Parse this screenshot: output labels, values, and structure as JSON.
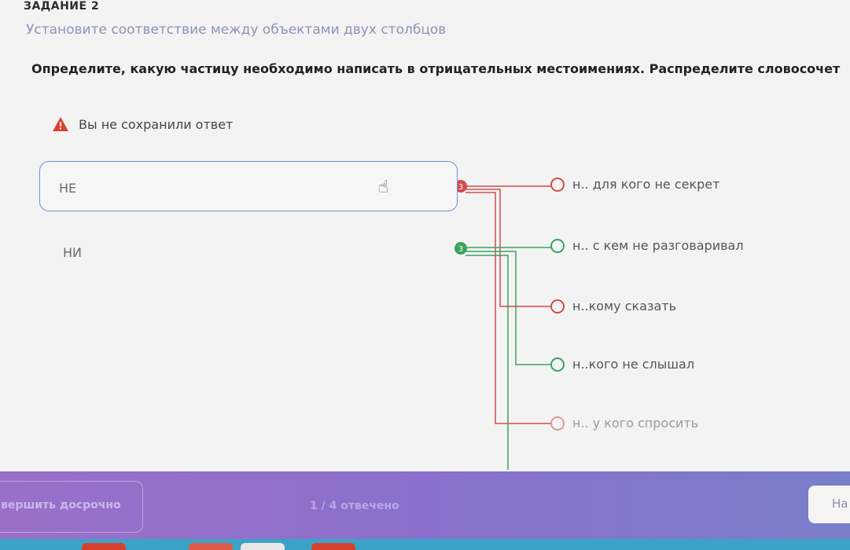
{
  "task": {
    "label": "ЗАДАНИЕ 2",
    "subtitle": "Установите соответствие между объектами двух столбцов",
    "question": "Определите, какую частицу необходимо написать в отрицательных местоимениях. Распределите словосочет"
  },
  "warning": {
    "text": "Вы не сохранили ответ",
    "icon": "warning-icon"
  },
  "left_items": [
    {
      "label": "НЕ",
      "badge": "3",
      "color": "#d24b4b"
    },
    {
      "label": "НИ",
      "badge": "3",
      "color": "#3aa35f"
    }
  ],
  "right_items": [
    {
      "label": "н.. для кого не секрет"
    },
    {
      "label": "н.. с кем не разговаривал"
    },
    {
      "label": "н..кому сказать"
    },
    {
      "label": "н..кого не слышал"
    },
    {
      "label": "н.. у кого спросить"
    }
  ],
  "footer": {
    "finish_label": "вершить досрочно",
    "progress": "1 / 4 отвечено",
    "next_label": "На"
  },
  "colors": {
    "red_line": "#d24b4b",
    "green_line": "#3aa35f",
    "footer_accent": "#8a70cc"
  }
}
